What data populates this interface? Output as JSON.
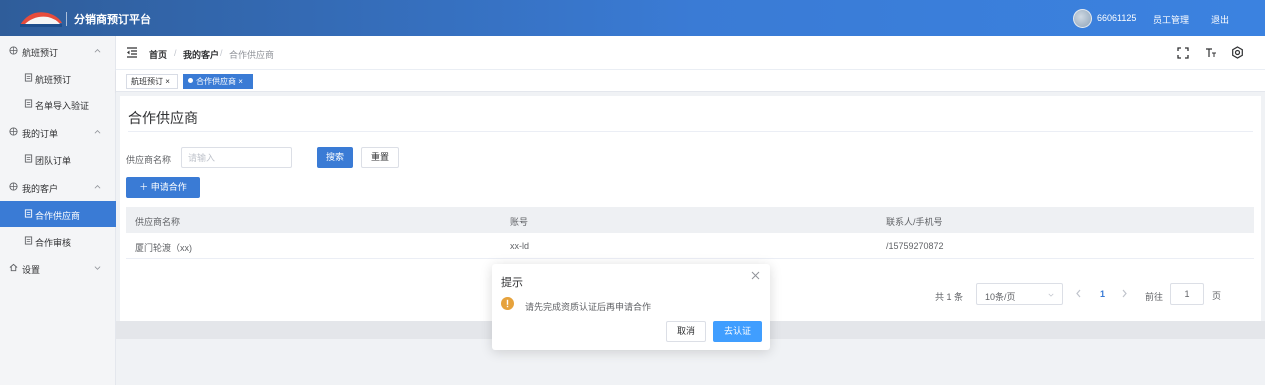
{
  "header": {
    "title": "分销商预订平台",
    "user_id": "66061125",
    "employee_link": "员工管理",
    "logout_link": "退出"
  },
  "sidebar": {
    "items": [
      {
        "label": "航班预订",
        "icon": "grid-icon",
        "expanded": true
      },
      {
        "label": "航班预订",
        "icon": "doc-icon"
      },
      {
        "label": "名单导入验证",
        "icon": "doc-icon"
      },
      {
        "label": "我的订单",
        "icon": "grid-icon",
        "expanded": true
      },
      {
        "label": "团队订单",
        "icon": "doc-icon"
      },
      {
        "label": "我的客户",
        "icon": "grid-icon",
        "expanded": true
      },
      {
        "label": "合作供应商",
        "icon": "doc-icon",
        "active": true
      },
      {
        "label": "合作审核",
        "icon": "doc-icon"
      },
      {
        "label": "设置",
        "icon": "home-icon",
        "expanded": false
      }
    ]
  },
  "breadcrumb": {
    "home": "首页",
    "separator": "/",
    "customers": "我的客户",
    "current": "合作供应商"
  },
  "tags": {
    "flight": "航班预订 ×",
    "partner": "合作供应商 ×"
  },
  "main": {
    "title": "合作供应商",
    "search_label": "供应商名称",
    "search_placeholder": "请输入",
    "search_button": "搜索",
    "reset_button": "重置",
    "apply_button": "＋ 申请合作"
  },
  "table": {
    "columns": [
      "供应商名称",
      "账号",
      "联系人/手机号"
    ],
    "rows": [
      [
        "厦门轮渡（xx)",
        "xx-ld",
        "/15759270872"
      ]
    ]
  },
  "pagination": {
    "total": "共 1 条",
    "page_size": "10条/页",
    "current_page": "1",
    "goto_label": "前往",
    "goto_value": "1",
    "unit": "页"
  },
  "dialog": {
    "title": "提示",
    "message": "请先完成资质认证后再申请合作",
    "cancel": "取消",
    "confirm": "去认证"
  },
  "colors": {
    "primary": "#3a7bd5",
    "warning": "#e6a23c",
    "confirm": "#409eff"
  }
}
